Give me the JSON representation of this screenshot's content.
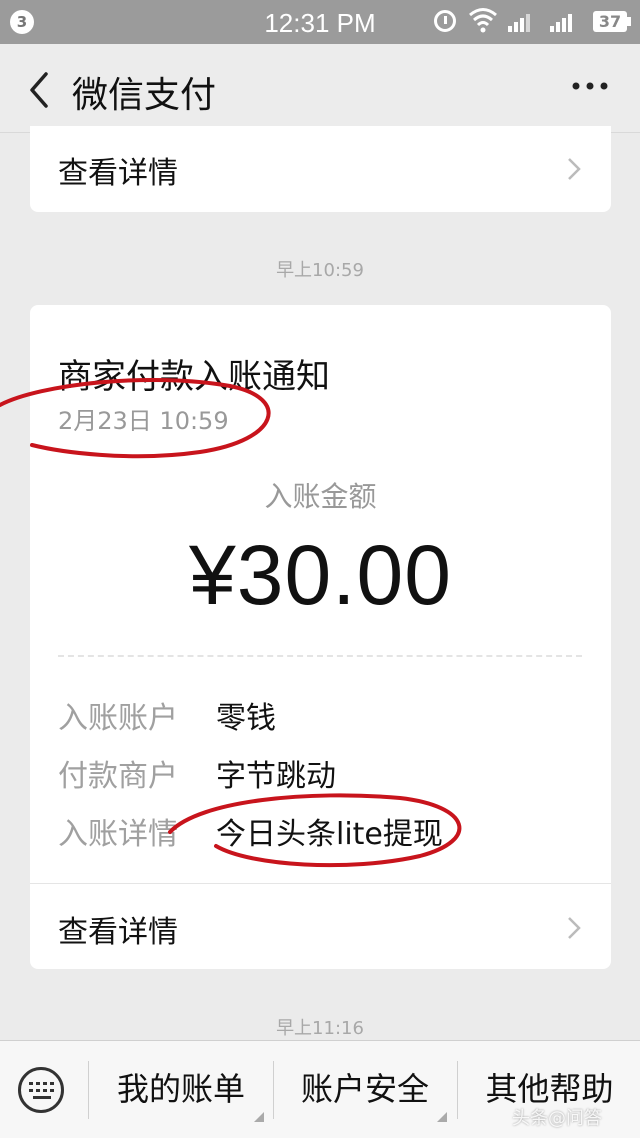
{
  "status_bar": {
    "notification_count": "3",
    "time": "12:31 PM",
    "battery": "37",
    "icons": [
      "alarm-icon",
      "wifi-icon",
      "signal-icon",
      "signal-icon",
      "battery-icon"
    ]
  },
  "nav": {
    "title": "微信支付",
    "back_icon": "chevron-left-icon",
    "more_icon": "more-dots-icon"
  },
  "messages": {
    "top_detail_label": "查看详情",
    "time_1": "早上10:59",
    "card": {
      "title": "商家付款入账通知",
      "date": "2月23日  10:59",
      "amount_label": "入账金额",
      "amount": "¥30.00",
      "rows": [
        {
          "key": "入账账户",
          "value": "零钱"
        },
        {
          "key": "付款商户",
          "value": "字节跳动"
        },
        {
          "key": "入账详情",
          "value": "今日头条lite提现"
        }
      ],
      "detail_label": "查看详情"
    },
    "time_2": "早上11:16"
  },
  "bottom_menu": {
    "keyboard_icon": "keyboard-icon",
    "items": [
      "我的账单",
      "账户安全",
      "其他帮助"
    ]
  },
  "colors": {
    "background": "#ebebeb",
    "card": "#ffffff",
    "status_bar": "#9b9b9b",
    "annotation": "#c8141c"
  },
  "watermark": "头条@问答"
}
